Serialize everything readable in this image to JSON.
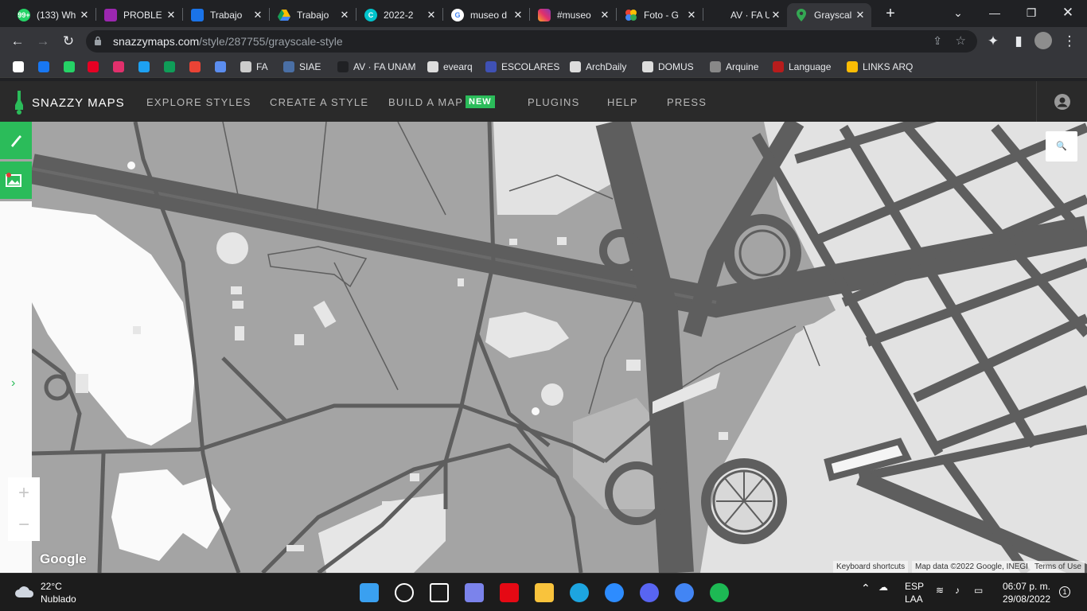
{
  "browser": {
    "tabs": [
      {
        "title": "(133) Wh",
        "icon": "whatsapp-icon",
        "color": "#25d366",
        "badge": "99+"
      },
      {
        "title": "PROBLE",
        "icon": "classroom-icon",
        "color": "#9c27b0",
        "badge": ""
      },
      {
        "title": "Trabajo",
        "icon": "classroom-icon",
        "color": "#1a73e8",
        "badge": ""
      },
      {
        "title": "Trabajo",
        "icon": "google-drive-icon",
        "color": "#fbbc04",
        "badge": ""
      },
      {
        "title": "2022-2",
        "icon": "canva-icon",
        "color": "#00c4cc",
        "badge": ""
      },
      {
        "title": "museo d",
        "icon": "google-icon",
        "color": "#ffffff",
        "badge": ""
      },
      {
        "title": "#museo",
        "icon": "instagram-icon",
        "color": "#e1306c",
        "badge": ""
      },
      {
        "title": "Foto - G",
        "icon": "google-photos-icon",
        "color": "#ea4335",
        "badge": ""
      },
      {
        "title": "AV · FA U",
        "icon": "fa-unam-icon",
        "color": "#202124",
        "badge": ""
      },
      {
        "title": "Grayscal",
        "icon": "google-maps-icon",
        "color": "#34a853",
        "badge": ""
      }
    ],
    "url_host": "snazzymaps.com",
    "url_path": "/style/287755/grayscale-style",
    "bookmarks": [
      {
        "label": "",
        "icon": "google-icon",
        "color": "#ffffff"
      },
      {
        "label": "",
        "icon": "facebook-icon",
        "color": "#1877f2"
      },
      {
        "label": "",
        "icon": "whatsapp-icon",
        "color": "#25d366"
      },
      {
        "label": "",
        "icon": "pinterest-icon",
        "color": "#e60023"
      },
      {
        "label": "",
        "icon": "instagram-icon",
        "color": "#e1306c"
      },
      {
        "label": "",
        "icon": "twitter-icon",
        "color": "#1da1f2"
      },
      {
        "label": "",
        "icon": "classroom-icon",
        "color": "#0f9d58"
      },
      {
        "label": "",
        "icon": "gmail-icon",
        "color": "#ea4335"
      },
      {
        "label": "",
        "icon": "unam-icon",
        "color": "#5b8def"
      },
      {
        "label": "FA",
        "icon": "fa-icon",
        "color": "#cccccc"
      },
      {
        "label": "SIAE",
        "icon": "siae-icon",
        "color": "#4a6fa5"
      },
      {
        "label": "AV · FA UNAM",
        "icon": "av-icon",
        "color": "#202124"
      },
      {
        "label": "evearq",
        "icon": "evearq-icon",
        "color": "#dddddd"
      },
      {
        "label": "ESCOLARES",
        "icon": "escolares-icon",
        "color": "#3f51b5"
      },
      {
        "label": "ArchDaily",
        "icon": "archdaily-icon",
        "color": "#dddddd"
      },
      {
        "label": "DOMUS",
        "icon": "domus-icon",
        "color": "#dddddd"
      },
      {
        "label": "Arquine",
        "icon": "arquine-icon",
        "color": "#888888"
      },
      {
        "label": "Language",
        "icon": "language-icon",
        "color": "#b71c1c"
      },
      {
        "label": "LINKS ARQ",
        "icon": "keep-icon",
        "color": "#fbbc04"
      }
    ]
  },
  "site": {
    "logo": "SNAZZY MAPS",
    "nav": [
      "EXPLORE STYLES",
      "CREATE A STYLE",
      "BUILD A MAP",
      "PLUGINS",
      "HELP",
      "PRESS"
    ],
    "new_badge": "NEW",
    "accent": "#2bbc5a"
  },
  "map": {
    "zoom_in": "+",
    "zoom_out": "−",
    "search_icon": "🔍",
    "google_logo": "Google",
    "attribution": [
      "Keyboard shortcuts",
      "Map data ©2022 Google, INEGI",
      "Terms of Use"
    ],
    "expand_arrow": "›"
  },
  "taskbar": {
    "temperature": "22°C",
    "weather": "Nublado",
    "language": "ESP",
    "layout": "LAA",
    "time": "06:07 p. m.",
    "date": "29/08/2022",
    "notifications": "1",
    "apps": [
      {
        "name": "windows-start-icon",
        "color": "#3aa0f0"
      },
      {
        "name": "search-icon",
        "color": "#ffffff"
      },
      {
        "name": "task-view-icon",
        "color": "#ffffff"
      },
      {
        "name": "teams-chat-icon",
        "color": "#7b83eb"
      },
      {
        "name": "netflix-icon",
        "color": "#e50914"
      },
      {
        "name": "file-explorer-icon",
        "color": "#f9c33c"
      },
      {
        "name": "edge-icon",
        "color": "#1da5e0"
      },
      {
        "name": "zoom-icon",
        "color": "#2d8cff"
      },
      {
        "name": "discord-icon",
        "color": "#5865f2"
      },
      {
        "name": "chrome-icon",
        "color": "#4285f4"
      },
      {
        "name": "spotify-icon",
        "color": "#1db954"
      }
    ]
  }
}
